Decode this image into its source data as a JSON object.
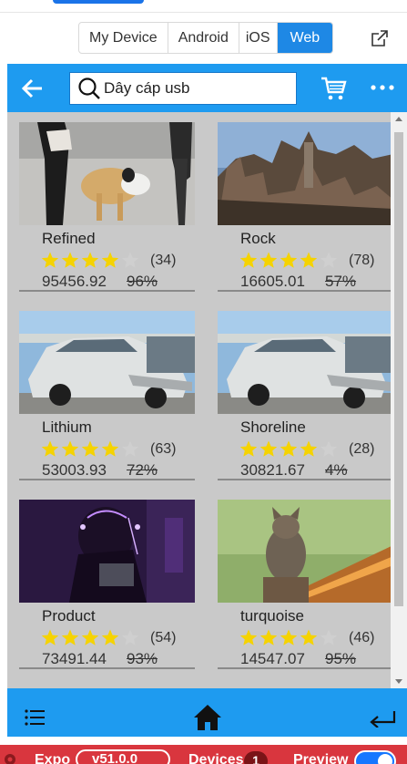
{
  "platform_tabs": [
    {
      "label": "My Device",
      "active": false
    },
    {
      "label": "Android",
      "active": false
    },
    {
      "label": "iOS",
      "active": false
    },
    {
      "label": "Web",
      "active": true
    }
  ],
  "header": {
    "search_value": "Dây cáp usb"
  },
  "products": [
    {
      "name": "Refined",
      "rating": 4,
      "max_rating": 5,
      "count": "(34)",
      "price": "95456.92",
      "discount": "96%"
    },
    {
      "name": "Rock",
      "rating": 4,
      "max_rating": 5,
      "count": "(78)",
      "price": "16605.01",
      "discount": "57%"
    },
    {
      "name": "Lithium",
      "rating": 4,
      "max_rating": 5,
      "count": "(63)",
      "price": "53003.93",
      "discount": "72%"
    },
    {
      "name": "Shoreline",
      "rating": 4,
      "max_rating": 5,
      "count": "(28)",
      "price": "30821.67",
      "discount": "4%"
    },
    {
      "name": "Product",
      "rating": 4,
      "max_rating": 5,
      "count": "(54)",
      "price": "73491.44",
      "discount": "93%"
    },
    {
      "name": "turquoise",
      "rating": 4,
      "max_rating": 5,
      "count": "(46)",
      "price": "14547.07",
      "discount": "95%"
    }
  ],
  "expo_bar": {
    "app_label": "Expo",
    "version_label": "v51.0.0",
    "devices_label": "Devices",
    "devices_count": "1",
    "preview_label": "Preview"
  },
  "colors": {
    "header_blue": "#1e9bf0",
    "star_gold": "#f5d300",
    "star_gray": "#cfcfcf",
    "expo_red": "#d9363e"
  },
  "icons": {
    "back": "arrow-left-icon",
    "search": "search-icon",
    "cart": "cart-icon",
    "more": "more-horizontal-icon",
    "menu": "list-icon",
    "home": "home-icon",
    "return": "return-arrow-icon",
    "external": "open-external-icon"
  }
}
